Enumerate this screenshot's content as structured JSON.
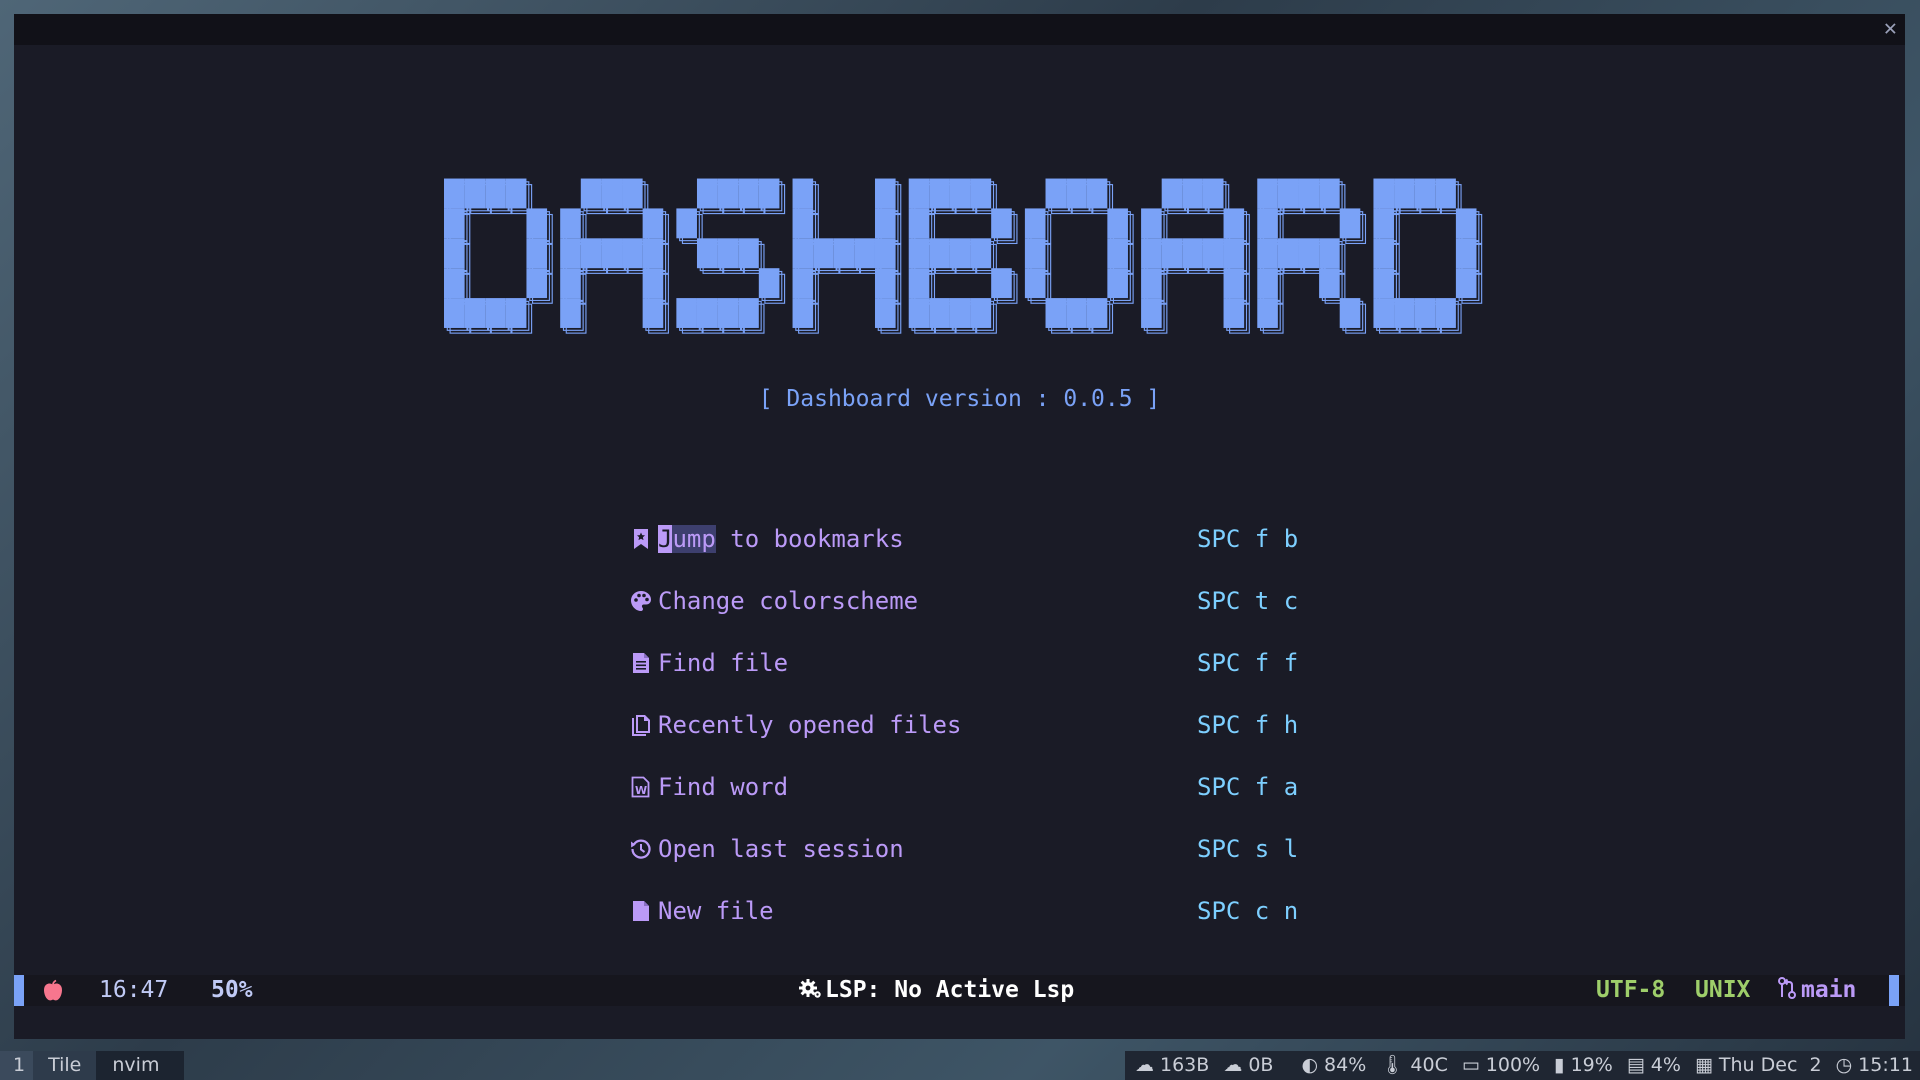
{
  "banner": {
    "text": "DASHBOARD",
    "color": "#7aa2f7"
  },
  "version": "[ Dashboard version : 0.0.5 ]",
  "menu": [
    {
      "icon": "bookmark-icon",
      "label": "Jump to bookmarks",
      "key": "SPC f b",
      "cursor_word": "Jump"
    },
    {
      "icon": "palette-icon",
      "label": "Change colorscheme",
      "key": "SPC t c"
    },
    {
      "icon": "file-text-icon",
      "label": "Find file",
      "key": "SPC f f"
    },
    {
      "icon": "files-icon",
      "label": "Recently opened files",
      "key": "SPC f h"
    },
    {
      "icon": "word-file-icon",
      "label": "Find word",
      "key": "SPC f a"
    },
    {
      "icon": "history-icon",
      "label": "Open last session",
      "key": "SPC s l"
    },
    {
      "icon": "new-file-icon",
      "label": "New file",
      "key": "SPC c n"
    }
  ],
  "statusline": {
    "time": "16:47",
    "percent": "50%",
    "lsp": "LSP: No Active Lsp",
    "encoding": "UTF-8",
    "format": "UNIX",
    "branch": "main"
  },
  "sysbar": {
    "workspace": "1",
    "layout": "Tile",
    "window": "nvim",
    "net_up": "163B",
    "net_down": "0B",
    "brightness": "84%",
    "temperature": "40C",
    "battery": "100%",
    "disk": "19%",
    "memory": "4%",
    "date": "Thu Dec  2",
    "clock": "15:11"
  },
  "colors": {
    "background": "#1a1b26",
    "blue": "#7aa2f7",
    "purple": "#bb9af7",
    "cyan": "#7dcfff",
    "green": "#9ece6a"
  }
}
